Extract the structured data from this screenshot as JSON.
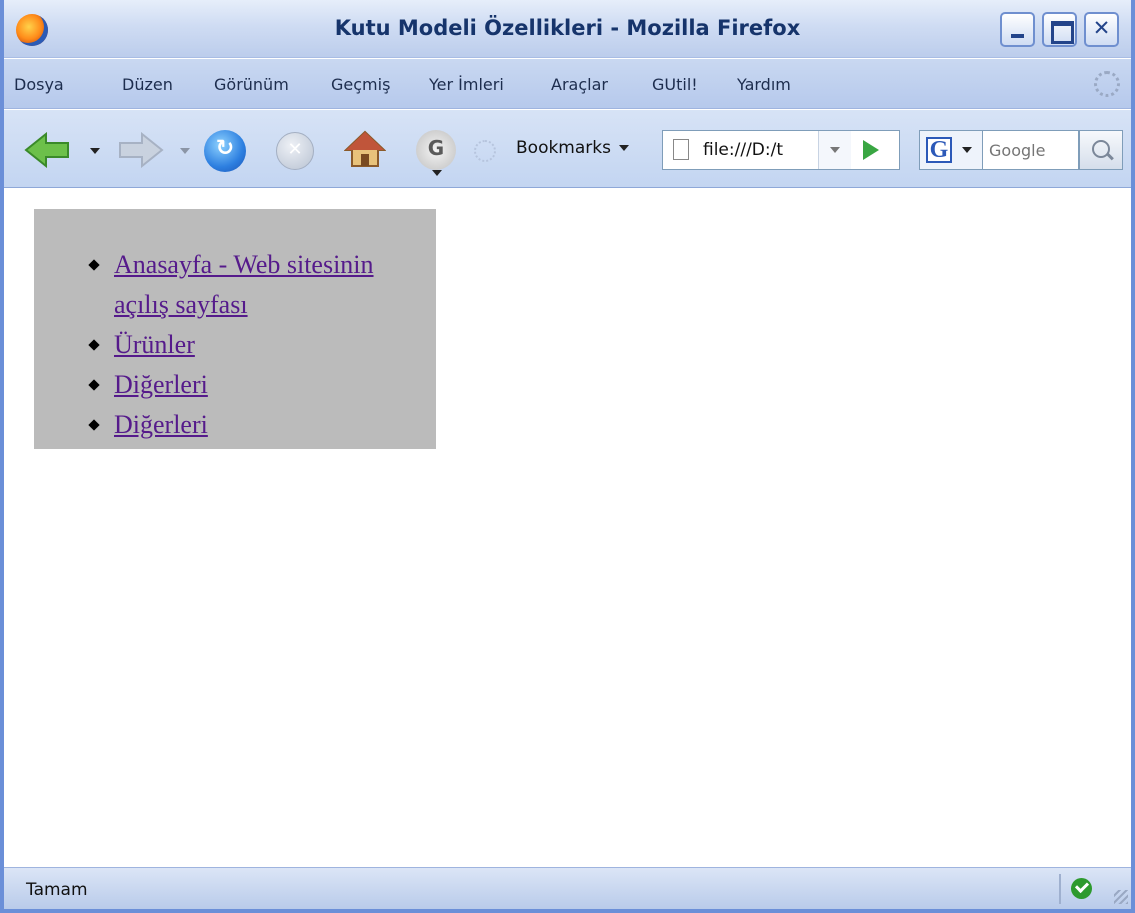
{
  "window": {
    "title": "Kutu Modeli Özellikleri - Mozilla Firefox",
    "close_glyph": "✕"
  },
  "menubar": {
    "items": [
      "Dosya",
      "Düzen",
      "Görünüm",
      "Geçmiş",
      "Yer İmleri",
      "Araçlar",
      "GUtil!",
      "Yardım"
    ]
  },
  "toolbar": {
    "bookmarks_label": "Bookmarks",
    "url_value": "file:///D:/t",
    "search_placeholder": "Google",
    "search_engine_letter": "G",
    "gutil_letter": "G"
  },
  "content": {
    "nav_links": [
      "Anasayfa - Web sitesinin açılış sayfası",
      "Ürünler",
      "Diğerleri",
      "Diğerleri"
    ]
  },
  "statusbar": {
    "text": "Tamam"
  },
  "colors": {
    "nav_box_bg": "#bbbbbb",
    "link_visited": "#551a8b",
    "chrome_blue": "#6b8fd8"
  }
}
